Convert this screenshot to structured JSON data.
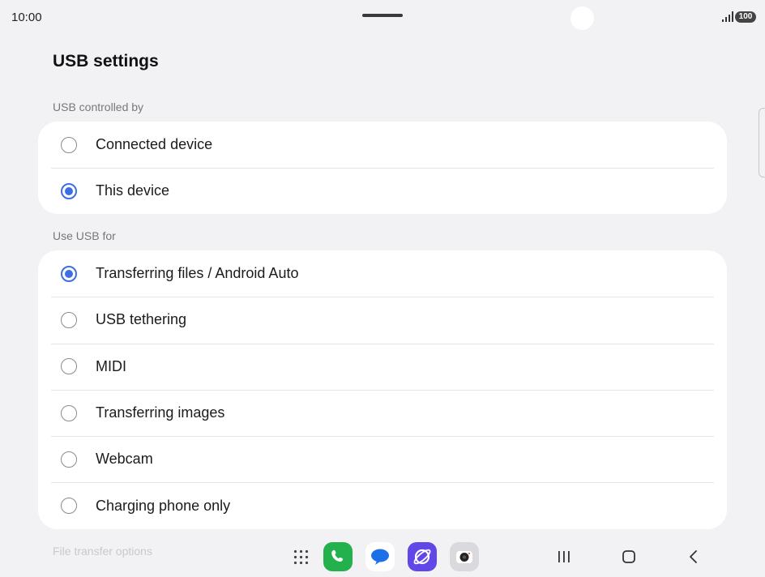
{
  "status_bar": {
    "time": "10:00",
    "battery": "100",
    "icons": [
      "signal-icon",
      "battery-icon"
    ]
  },
  "page": {
    "title": "USB settings"
  },
  "usb_controlled_by": {
    "header": "USB controlled by",
    "options": [
      {
        "label": "Connected device",
        "selected": false
      },
      {
        "label": "This device",
        "selected": true
      }
    ]
  },
  "use_usb_for": {
    "header": "Use USB for",
    "options": [
      {
        "label": "Transferring files / Android Auto",
        "selected": true
      },
      {
        "label": "USB tethering",
        "selected": false
      },
      {
        "label": "MIDI",
        "selected": false
      },
      {
        "label": "Transferring images",
        "selected": false
      },
      {
        "label": "Webcam",
        "selected": false
      },
      {
        "label": "Charging phone only",
        "selected": false
      }
    ]
  },
  "file_transfer": {
    "header": "File transfer options"
  },
  "taskbar": {
    "apps": [
      "app-drawer-icon",
      "phone-icon",
      "messages-icon",
      "internet-icon",
      "camera-icon"
    ],
    "nav": [
      "recents-icon",
      "home-icon",
      "back-icon"
    ]
  },
  "colors": {
    "accent": "#3e6fe0",
    "background": "#f2f2f4",
    "card": "#ffffff",
    "phone_green": "#23b14d",
    "internet_purple": "#6247e8"
  }
}
